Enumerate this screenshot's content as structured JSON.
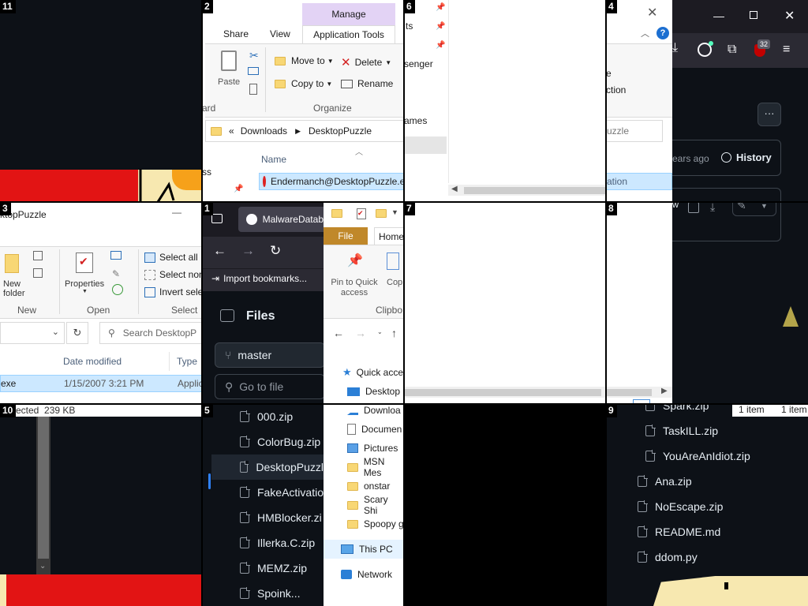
{
  "tile_numbers": {
    "t11": "11",
    "t2": "2",
    "t6": "6",
    "t4": "4",
    "t3": "3",
    "t1": "1",
    "t7": "7",
    "t8": "8",
    "t10": "10",
    "t5": "5",
    "t9": "9"
  },
  "tile2": {
    "manage_tab": "Manage",
    "tabs": [
      "Share",
      "View",
      "Application Tools"
    ],
    "paste": "Paste",
    "move_to": "Move to",
    "copy_to": "Copy to",
    "delete": "Delete",
    "rename": "Rename",
    "group_clipboard_partial": "ard",
    "group_organize": "Organize",
    "breadcrumb_prefix": "«",
    "breadcrumb": [
      "Downloads",
      "DesktopPuzzle"
    ],
    "col_name": "Name",
    "nav_partial": "ss",
    "file_selected": "Endermanch@DesktopPuzzle.e"
  },
  "tile6": {
    "items": [
      "ts",
      "senger",
      "ames"
    ]
  },
  "tile4": {
    "ribbon_partial_1": "e",
    "ribbon_partial_2": "ction",
    "search_partial": "uzzle",
    "row_partial": "ation"
  },
  "tile12": {
    "notification_count": "32",
    "more_label": "···",
    "time_partial": "ears ago",
    "history": "History"
  },
  "tile3": {
    "title_partial": "ktopPuzzle",
    "new_folder": "New folder",
    "properties": "Properties",
    "select_all": "Select all",
    "select_none_partial": "Select non",
    "invert_partial": "Invert sele",
    "group_new": "New",
    "group_open": "Open",
    "group_select": "Select",
    "search_placeholder": "Search DesktopP",
    "col_date": "Date modified",
    "col_type": "Type",
    "row_name_partial": "exe",
    "row_date": "1/15/2007 3:21 PM",
    "row_type_partial": "Applic"
  },
  "tile1": {
    "tab_title": "MalwareDatab",
    "import_bookmarks": "Import bookmarks...",
    "files_heading": "Files",
    "branch": "master",
    "go_to_file": "Go to file",
    "file_tab": "File",
    "home_tab": "Home",
    "pin_quick_access": "Pin to Quick access",
    "copy_partial": "Cop",
    "clipboard_partial": "Clipbo",
    "quick_access_partial": "Quick acce",
    "desktop": "Desktop"
  },
  "tile10": {
    "status_partial": "ected  239 KB"
  },
  "tile5": {
    "files": [
      "000.zip",
      "ColorBug.zip",
      "DesktopPuzzl",
      "FakeActivatio",
      "HMBlocker.zi",
      "Illerka.C.zip",
      "MEMZ.zip",
      "Spoink..."
    ]
  },
  "tile_nav": {
    "items": [
      "Downloa",
      "Documen",
      "Pictures",
      "MSN Mes",
      "onstar",
      "Scary Shi",
      "Spoopy g",
      "This PC",
      "Network"
    ]
  },
  "tile9": {
    "status_left": "1 item",
    "status_right": "1 item",
    "files_indented": [
      "Spark.zip",
      "TaskILL.zip",
      "YouAreAnIdiot.zip"
    ],
    "files_root": [
      "Ana.zip",
      "NoEscape.zip",
      "README.md",
      "ddom.py"
    ]
  },
  "colors": {
    "selection_blue": "#cce8ff",
    "ribbon_file_tab": "#c0882a",
    "manage_tab_bg": "#e3d3f5",
    "github_dark_bg": "#0d1117",
    "accent_blue": "#2f81f7"
  }
}
